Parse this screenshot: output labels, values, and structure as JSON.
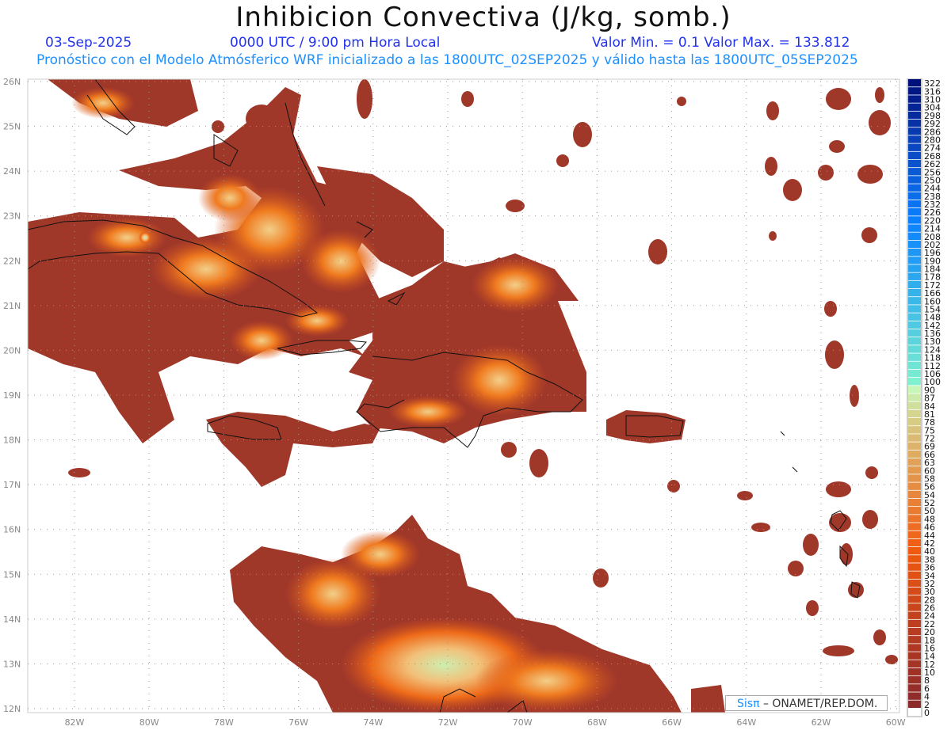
{
  "header": {
    "title": "Inhibicion Convectiva (J/kg, somb.)",
    "date": "03-Sep-2025",
    "time": "0000 UTC / 9:00 pm Hora Local",
    "minmax": "Valor Min. = 0.1  Valor Max. = 133.812",
    "forecast": "Pronóstico con el Modelo Atmósferico WRF inicializado a las 1800UTC_02SEP2025 y válido hasta las  1800UTC_05SEP2025"
  },
  "map": {
    "lat_labels": [
      "26N",
      "25N",
      "24N",
      "23N",
      "22N",
      "21N",
      "20N",
      "19N",
      "18N",
      "17N",
      "16N",
      "15N",
      "14N",
      "13N",
      "12N"
    ],
    "lon_labels": [
      "82W",
      "80W",
      "78W",
      "76W",
      "74W",
      "72W",
      "70W",
      "68W",
      "66W",
      "64W",
      "62W",
      "60W"
    ],
    "field_colors": {
      "low": "#a0382a",
      "mid": "#d2501c",
      "high": "#f07a1e",
      "peak": "#f2cf8a",
      "max": "#cdeeb0"
    }
  },
  "colorbar": {
    "labels": [
      322,
      316,
      310,
      304,
      298,
      292,
      286,
      280,
      274,
      268,
      262,
      256,
      250,
      244,
      238,
      232,
      226,
      220,
      214,
      208,
      202,
      196,
      190,
      184,
      178,
      172,
      166,
      160,
      154,
      148,
      142,
      136,
      130,
      124,
      118,
      112,
      106,
      100,
      90,
      87,
      84,
      81,
      78,
      75,
      72,
      69,
      66,
      63,
      60,
      58,
      56,
      54,
      52,
      50,
      48,
      46,
      44,
      42,
      40,
      38,
      36,
      34,
      32,
      30,
      28,
      26,
      24,
      22,
      20,
      18,
      16,
      14,
      12,
      10,
      8,
      6,
      4,
      2,
      0
    ],
    "stops": [
      [
        0,
        "#ffffff"
      ],
      [
        2,
        "#8b2a2a"
      ],
      [
        20,
        "#b83c22"
      ],
      [
        40,
        "#f05a0f"
      ],
      [
        60,
        "#e29a50"
      ],
      [
        80,
        "#d6d18a"
      ],
      [
        90,
        "#c8f5b8"
      ],
      [
        100,
        "#7ff0d0"
      ],
      [
        160,
        "#3ab8e8"
      ],
      [
        220,
        "#0a80ff"
      ],
      [
        280,
        "#0a40b8"
      ],
      [
        322,
        "#00107a"
      ]
    ]
  },
  "credit": {
    "logo": "Sisπ",
    "text": " –  ONAMET/REP.DOM."
  }
}
